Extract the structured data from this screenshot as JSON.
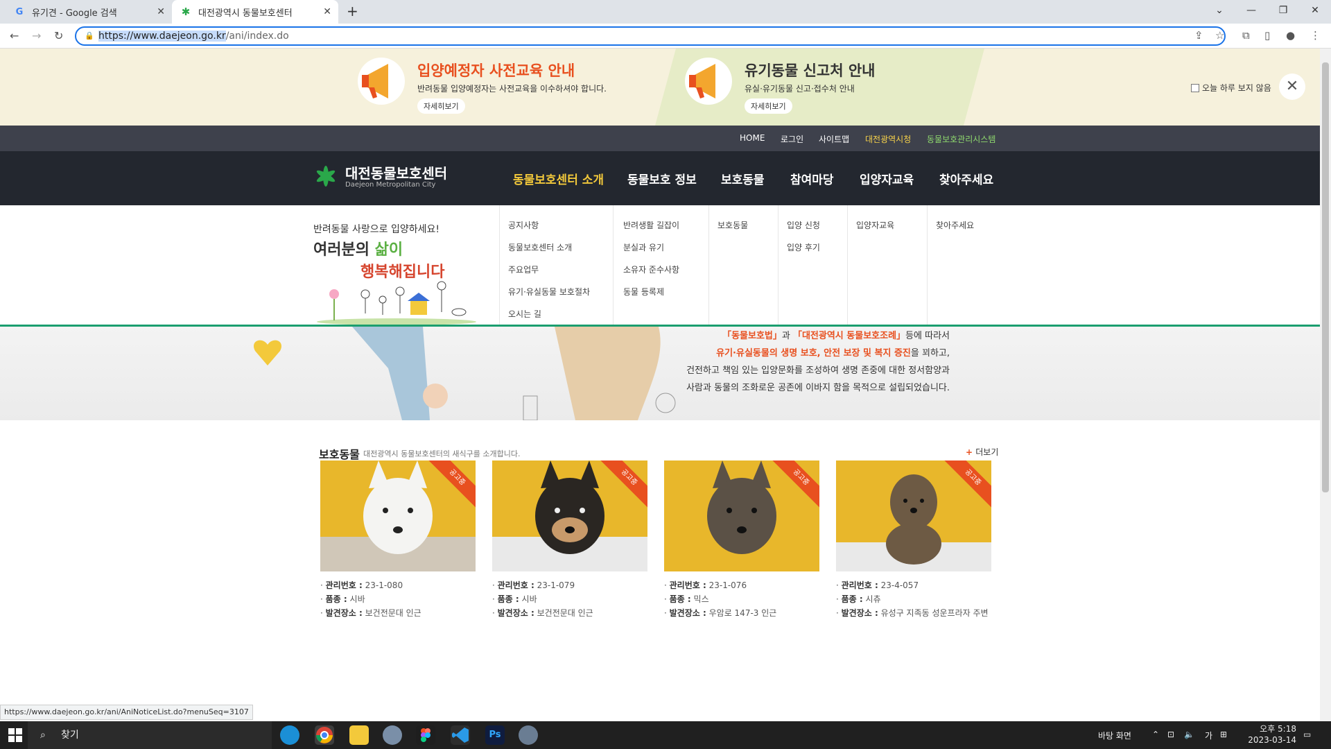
{
  "browser": {
    "tabs": [
      {
        "title": "유기견 - Google 검색",
        "icon": "google-icon"
      },
      {
        "title": "대전광역시 동물보호센터",
        "icon": "daejeon-favicon"
      }
    ],
    "url_selected": "https://www.daejeon.go.kr",
    "url_rest": "/ani/index.do",
    "status_url": "https://www.daejeon.go.kr/ani/AniNoticeList.do?menuSeq=3107"
  },
  "banner": {
    "left": {
      "title": "입양예정자 사전교육 안내",
      "sub": "반려동물 입양예정자는 사전교육을 이수하셔야 합니다.",
      "btn": "자세히보기"
    },
    "right": {
      "title": "유기동물 신고처 안내",
      "sub": "유실·유기동물 신고·접수처 안내",
      "btn": "자세히보기"
    },
    "dont_show": "오늘 하루 보지 않음",
    "title_color": "#e8501f"
  },
  "util_links": [
    "HOME",
    "로그인",
    "사이트맵",
    "대전광역시청",
    "동물보호관리시스템"
  ],
  "logo": {
    "title": "대전동물보호센터",
    "sub": "Daejeon Metropolitan City"
  },
  "gnb": [
    "동물보호센터 소개",
    "동물보호 정보",
    "보호동물",
    "참여마당",
    "입양자교육",
    "찾아주세요"
  ],
  "mega": {
    "greeting": "반려동물 사랑으로 입양하세요!",
    "hand1a": "여러분의 ",
    "hand1b": "삶이",
    "hand2": "행복해집니다",
    "cols": [
      [
        "공지사항",
        "동물보호센터 소개",
        "주요업무",
        "유기·유실동물 보호절차",
        "오시는 길"
      ],
      [
        "반려생활 길잡이",
        "분실과 유기",
        "소유자 준수사항",
        "동물 등록제"
      ],
      [
        "보호동물"
      ],
      [
        "입양 신청",
        "입양 후기"
      ],
      [
        "입양자교육"
      ],
      [
        "찾아주세요"
      ]
    ]
  },
  "hero": {
    "l1a": "「동물보호법」",
    "l1b": "과 ",
    "l1c": "「대전광역시 동물보호조례」",
    "l1d": "등에 따라서",
    "l2a": "유기·유실동물의 생명 보호, 안전 보장 및 복지 증진",
    "l2b": "을 꾀하고,",
    "l3": "건전하고 책임 있는 입양문화를 조성하여 생명 존중에 대한 정서함양과",
    "l4": "사람과 동물의 조화로운 공존에 이바지 함을 목적으로 설립되었습니다."
  },
  "section": {
    "title": "보호동물",
    "sub": "대전광역시 동물보호센터의 새식구를 소개합니다.",
    "more": "더보기",
    "labels": {
      "id": "관리번호 :",
      "breed": "품종 :",
      "place": "발견장소 :"
    },
    "ribbon": "공고중",
    "animals": [
      {
        "id": "23-1-080",
        "breed": "시바",
        "place": "보건전문대 인근",
        "fur": "#f4f4f2"
      },
      {
        "id": "23-1-079",
        "breed": "시바",
        "place": "보건전문대 인근",
        "fur": "#2a2622"
      },
      {
        "id": "23-1-076",
        "breed": "믹스",
        "place": "우암로 147-3 인근",
        "fur": "#5b5146"
      },
      {
        "id": "23-4-057",
        "breed": "시츄",
        "place": "유성구 지족동 성운프라자 주변",
        "fur": "#6d5a44"
      }
    ]
  },
  "taskbar": {
    "search": "찾기",
    "desktop": "바탕 화면",
    "ime": "가",
    "time": "오후 5:18",
    "date": "2023-03-14"
  }
}
